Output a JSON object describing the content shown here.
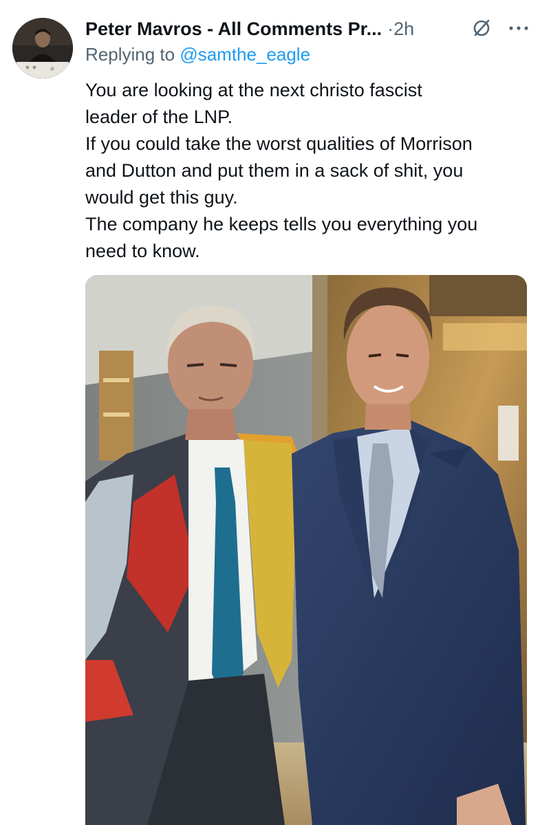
{
  "tweet": {
    "display_name": "Peter Mavros - All Comments Pr...",
    "separator": "·",
    "time": "2h",
    "replying_prefix": "Replying to ",
    "replying_handle": "@samthe_eagle",
    "body_lines": [
      "You are looking at the next christo fascist",
      "leader of the LNP.",
      "If you could take the worst qualities of Morrison",
      "and Dutton and put them in a sack of shit, you",
      "would get this guy.",
      "The company he keeps tells you everything you",
      "need to know."
    ]
  },
  "icons": {
    "avatar": "profile-photo",
    "grok": "grok-icon",
    "more": "more-dots-icon"
  },
  "colors": {
    "text": "#0f1419",
    "secondary": "#536471",
    "link": "#1d9bf0"
  }
}
